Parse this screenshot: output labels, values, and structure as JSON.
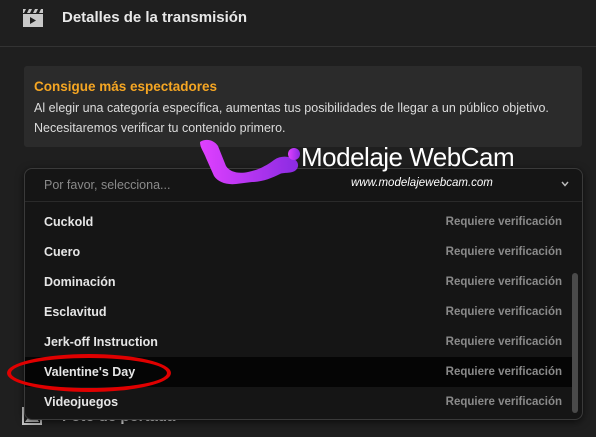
{
  "header": {
    "title": "Detalles de la transmisión",
    "icon": "clapperboard-icon"
  },
  "info": {
    "title": "Consigue más espectadores",
    "body": "Al elegir una categoría específica, aumentas tus posibilidades de llegar a un público objetivo. Necesitaremos verificar tu contenido primero.",
    "title_color": "#f5a623"
  },
  "select": {
    "placeholder": "Por favor, selecciona...",
    "options": [
      {
        "label": "Cuckold",
        "note": "Requiere verificación"
      },
      {
        "label": "Cuero",
        "note": "Requiere verificación"
      },
      {
        "label": "Dominación",
        "note": "Requiere verificación"
      },
      {
        "label": "Esclavitud",
        "note": "Requiere verificación"
      },
      {
        "label": "Jerk-off Instruction",
        "note": "Requiere verificación"
      },
      {
        "label": "Valentine's Day",
        "note": "Requiere verificación",
        "highlighted": true
      },
      {
        "label": "Videojuegos",
        "note": "Requiere verificación"
      }
    ]
  },
  "cover": {
    "label": "Foto de portada",
    "icon": "image-icon"
  },
  "watermark": {
    "title": "Modelaje WebCam",
    "url": "www.modelajewebcam.com",
    "color": "#cc33ff"
  },
  "annotation": {
    "color": "#e00000"
  }
}
